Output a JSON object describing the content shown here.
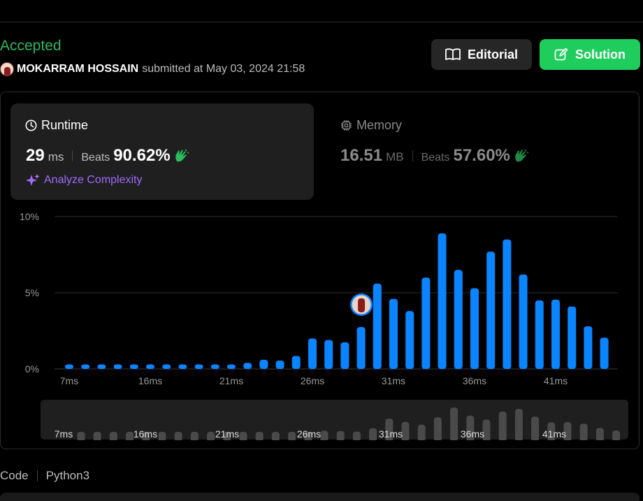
{
  "submission": {
    "status": "Accepted",
    "username": "MOKARRAM HOSSAIN",
    "submitted_text": "submitted at May 03, 2024 21:58"
  },
  "buttons": {
    "editorial": "Editorial",
    "solution": "Solution"
  },
  "runtime": {
    "title": "Runtime",
    "value": "29",
    "unit": "ms",
    "beats_label": "Beats",
    "beats_pct": "90.62%",
    "analyze": "Analyze Complexity"
  },
  "memory": {
    "title": "Memory",
    "value": "16.51",
    "unit": "MB",
    "beats_label": "Beats",
    "beats_pct": "57.60%"
  },
  "footer": {
    "code": "Code",
    "language": "Python3"
  },
  "colors": {
    "accepted": "#2cbb5d",
    "bar": "#0a84ff",
    "solution_button": "#1fcd5c",
    "analyze": "#a16bff",
    "hand": "#2cbb5d",
    "mini_bar": "#4a4a4a"
  },
  "chart_data": {
    "type": "bar",
    "ytick_labels": [
      "0%",
      "5%",
      "10%"
    ],
    "ylim": [
      0,
      10
    ],
    "x_tick_labels": [
      "7ms",
      "16ms",
      "21ms",
      "26ms",
      "31ms",
      "36ms",
      "41ms"
    ],
    "values": [
      0.3,
      0.3,
      0.3,
      0.3,
      0.3,
      0.3,
      0.3,
      0.3,
      0.3,
      0.3,
      0.3,
      0.4,
      0.6,
      0.55,
      0.85,
      2.0,
      1.9,
      1.75,
      2.75,
      5.6,
      4.6,
      3.8,
      6.0,
      8.9,
      6.5,
      5.3,
      7.7,
      8.5,
      6.2,
      4.5,
      4.55,
      4.1,
      2.8,
      2.05
    ],
    "highlight_index": 18,
    "grid": true
  }
}
